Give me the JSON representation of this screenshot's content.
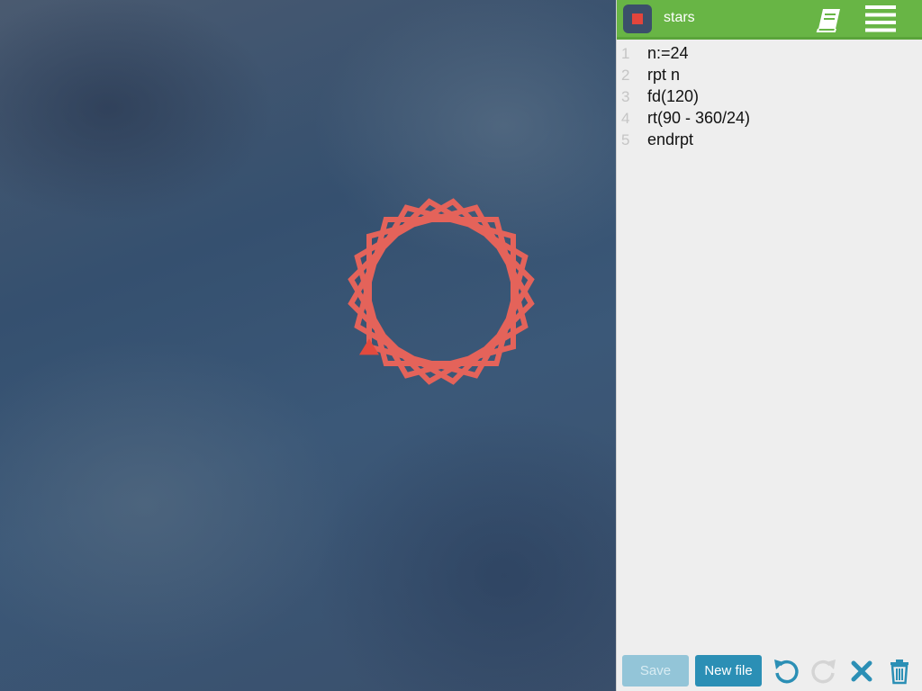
{
  "program": {
    "title": "stars",
    "lines": [
      {
        "num": "1",
        "code": "n:=24"
      },
      {
        "num": "2",
        "code": "rpt n"
      },
      {
        "num": "3",
        "code": "fd(120)"
      },
      {
        "num": "4",
        "code": "rt(90 - 360/24)"
      },
      {
        "num": "5",
        "code": "endrpt"
      }
    ]
  },
  "drawing": {
    "stroke_color": "#e4635a",
    "turtle_color": "#e24a3e",
    "repeat_count": 24,
    "forward_distance": 120,
    "turn_degrees": 75
  },
  "toolbar": {
    "save_label": "Save",
    "new_file_label": "New file"
  },
  "icons": {
    "stop": "stop-icon",
    "book": "book-icon",
    "menu": "menu-icon",
    "undo": "undo-icon",
    "redo": "redo-icon",
    "close": "close-icon",
    "trash": "trash-icon"
  },
  "colors": {
    "topbar": "#68b545",
    "accent": "#2b8fb5",
    "stop_square": "#e2453c"
  }
}
